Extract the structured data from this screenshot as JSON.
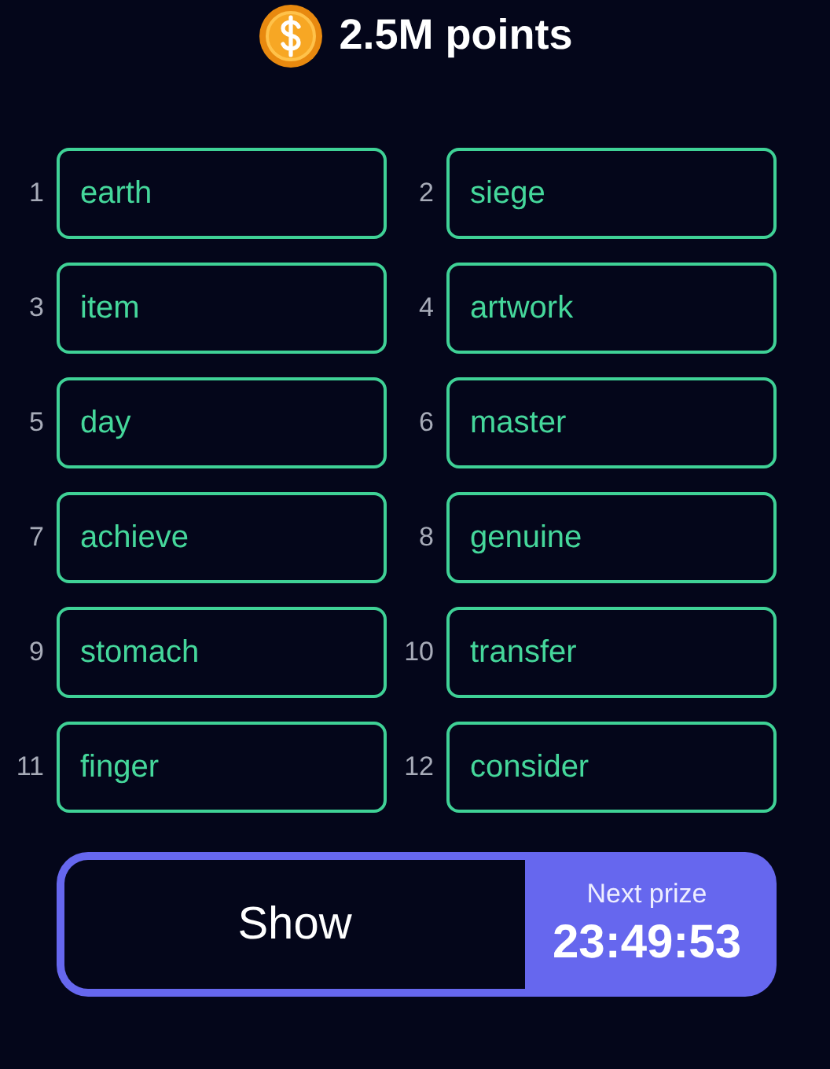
{
  "header": {
    "points": "2.5M points"
  },
  "words": [
    {
      "number": "1",
      "word": "earth"
    },
    {
      "number": "2",
      "word": "siege"
    },
    {
      "number": "3",
      "word": "item"
    },
    {
      "number": "4",
      "word": "artwork"
    },
    {
      "number": "5",
      "word": "day"
    },
    {
      "number": "6",
      "word": "master"
    },
    {
      "number": "7",
      "word": "achieve"
    },
    {
      "number": "8",
      "word": "genuine"
    },
    {
      "number": "9",
      "word": "stomach"
    },
    {
      "number": "10",
      "word": "transfer"
    },
    {
      "number": "11",
      "word": "finger"
    },
    {
      "number": "12",
      "word": "consider"
    }
  ],
  "action": {
    "button": "Show",
    "timer_label": "Next prize",
    "timer": "23:49:53"
  }
}
